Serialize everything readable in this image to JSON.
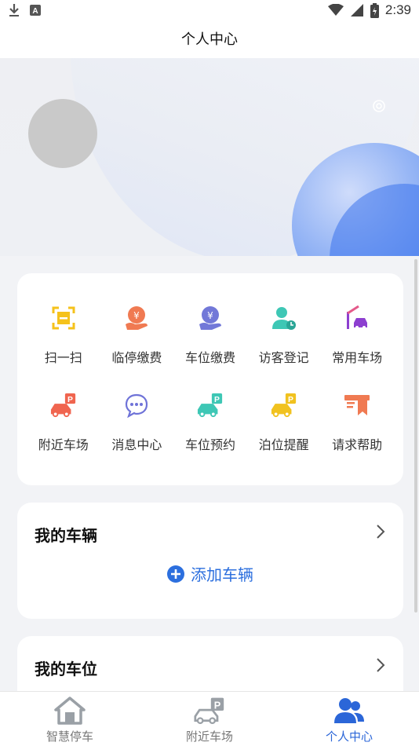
{
  "status_bar": {
    "time": "2:39",
    "icons": [
      "download-icon",
      "a-badge-icon",
      "wifi-icon",
      "signal-icon",
      "battery-icon"
    ]
  },
  "header": {
    "title": "个人中心"
  },
  "profile": {
    "avatar": "avatar-placeholder",
    "settings_icon": "gear-icon",
    "accent_blue": "#4d82ee"
  },
  "menu": {
    "items": [
      {
        "label": "扫一扫",
        "icon": "scan-icon",
        "color": "#f5c21b"
      },
      {
        "label": "临停缴费",
        "icon": "yuan-hand-icon",
        "color": "#f07a52"
      },
      {
        "label": "车位缴费",
        "icon": "yuan-hand-icon",
        "color": "#7278d8"
      },
      {
        "label": "访客登记",
        "icon": "visitor-icon",
        "color": "#3ec7b5"
      },
      {
        "label": "常用车场",
        "icon": "barrier-car-icon",
        "color": "#8d3fd0"
      },
      {
        "label": "附近车场",
        "icon": "parking-car-icon",
        "color": "#f0654f"
      },
      {
        "label": "消息中心",
        "icon": "chat-bubble-icon",
        "color": "#6f73d8"
      },
      {
        "label": "车位预约",
        "icon": "parking-car-icon",
        "color": "#3ec7b5"
      },
      {
        "label": "泊位提醒",
        "icon": "parking-car-icon",
        "color": "#f1c21f"
      },
      {
        "label": "请求帮助",
        "icon": "help-sign-icon",
        "color": "#f07a52"
      }
    ]
  },
  "my_vehicle": {
    "title": "我的车辆",
    "add_label": "添加车辆"
  },
  "my_space": {
    "title": "我的车位"
  },
  "bottom_nav": {
    "items": [
      {
        "label": "智慧停车",
        "icon": "home-icon",
        "active": false
      },
      {
        "label": "附近车场",
        "icon": "parking-car-icon",
        "active": false
      },
      {
        "label": "个人中心",
        "icon": "users-icon",
        "active": true
      }
    ],
    "active_color": "#2b66d8"
  }
}
